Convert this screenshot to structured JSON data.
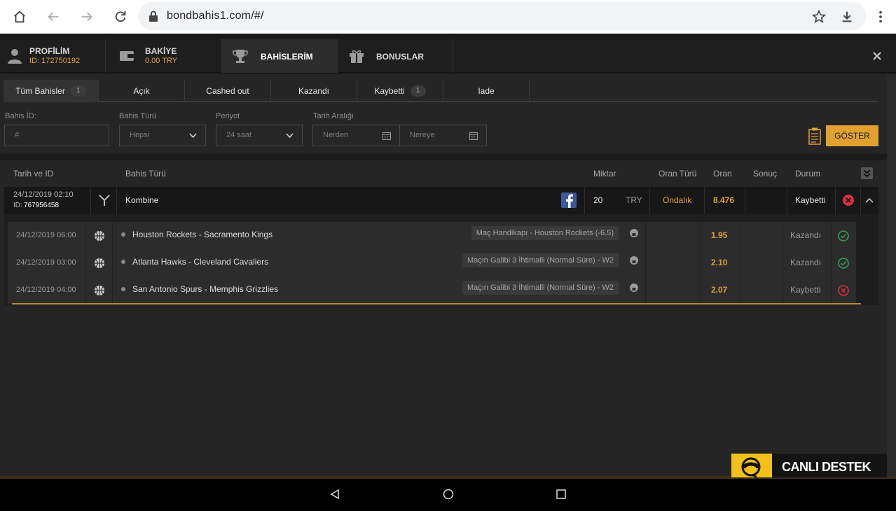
{
  "browser": {
    "url": "bondbahis1.com/#/"
  },
  "nav": {
    "profile_title": "PROFİLİM",
    "profile_id": "ID: 172750192",
    "balance_title": "BAKİYE",
    "balance_value": "0.00 TRY",
    "bets_title": "BAHİSLERİM",
    "bonus_title": "BONUSLAR"
  },
  "subtabs": {
    "all": "Tüm Bahisler",
    "all_count": "1",
    "open": "Açık",
    "cashed": "Cashed out",
    "won": "Kazandı",
    "lost": "Kaybetti",
    "lost_count": "1",
    "refund": "Iade"
  },
  "filters": {
    "bet_id_label": "Bahis İD:",
    "bet_id_placeholder": "#",
    "bet_type_label": "Bahis Türü",
    "bet_type_value": "Hepsi",
    "period_label": "Periyot",
    "period_value": "24 saat",
    "date_range_label": "Tarih Aralığı",
    "from_placeholder": "Nerden",
    "to_placeholder": "Nereye",
    "show_button": "GÖSTER"
  },
  "table": {
    "headers": {
      "date_id": "Tarih ve ID",
      "bet_type": "Bahis Türü",
      "amount": "Miktar",
      "odds_type": "Oran Türü",
      "odds": "Oran",
      "result": "Sonuç",
      "status": "Durum"
    },
    "bet": {
      "date": "24/12/2019 02:10",
      "id_label": "ID:",
      "id": "767956458",
      "type": "Kombine",
      "amount": "20",
      "currency": "TRY",
      "odds_type": "Ondalık",
      "odds": "8.476",
      "status": "Kaybetti"
    },
    "selections": [
      {
        "date": "24/12/2019 06:00",
        "match": "Houston Rockets - Sacramento Kings",
        "market": "Maç Handikapı - Houston Rockets (-6.5)",
        "odds": "1.95",
        "status": "Kazandı",
        "result": "won"
      },
      {
        "date": "24/12/2019 03:00",
        "match": "Atlanta Hawks - Cleveland Cavaliers",
        "market": "Maçın Galibi 3 İhtimalli (Normal Süre) - W2",
        "odds": "2.10",
        "status": "Kazandı",
        "result": "won"
      },
      {
        "date": "24/12/2019 04:00",
        "match": "San Antonio Spurs - Memphis Grizzlies",
        "market": "Maçın Galibi 3 İhtimalli (Normal Süre) - W2",
        "odds": "2.07",
        "status": "Kaybetti",
        "result": "lost"
      }
    ]
  },
  "support": {
    "label": "CANLI DESTEK"
  },
  "colors": {
    "accent": "#e0a12e",
    "won": "#2fa35a",
    "lost": "#d6303c"
  }
}
